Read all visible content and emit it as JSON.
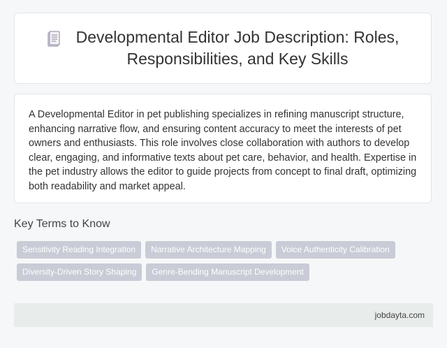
{
  "header": {
    "icon": "document-icon",
    "title_line1": "Developmental Editor Job Description: Roles,",
    "title_line2": "Responsibilities, and Key Skills"
  },
  "description": "A Developmental Editor in pet publishing specializes in refining manuscript structure, enhancing narrative flow, and ensuring content accuracy to meet the interests of pet owners and enthusiasts. This role involves close collaboration with authors to develop clear, engaging, and informative texts about pet care, behavior, and health. Expertise in the pet industry allows the editor to guide projects from concept to final draft, optimizing both readability and market appeal.",
  "key_terms": {
    "title": "Key Terms to Know",
    "tags": [
      "Sensitivity Reading Integration",
      "Narrative Architecture Mapping",
      "Voice Authenticity Calibration",
      "Diversity-Driven Story Shaping",
      "Genre-Bending Manuscript Development"
    ]
  },
  "footer": {
    "brand": "jobdayta.com"
  },
  "colors": {
    "tag_bg": "#c9ccd6",
    "footer_bg": "#e8ecea",
    "page_bg": "#f6f7f8"
  }
}
